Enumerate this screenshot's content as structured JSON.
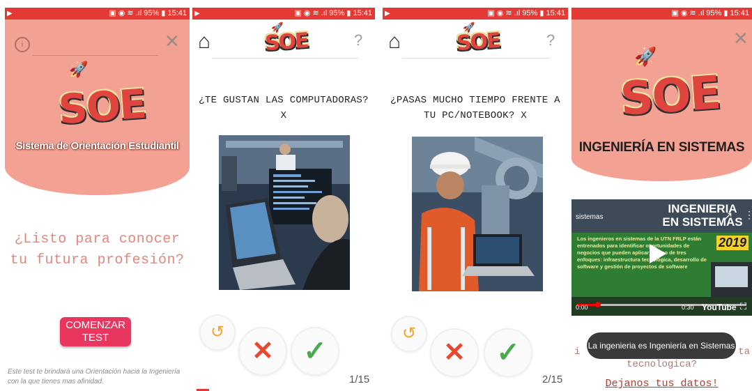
{
  "status_bar": {
    "battery": "95%",
    "time": "15:41"
  },
  "screen1": {
    "logo": "SOE",
    "subtitle": "Sistema de Orientación Estudiantil",
    "headline_line1": "¿Listo para conocer",
    "headline_line2": "tu futura profesión?",
    "start_button_line1": "COMENZAR",
    "start_button_line2": "TEST",
    "footnote_line1": "Este test te brindará una Orientación hacia la Ingeniería",
    "footnote_line2": "con la que tienes mas afinidad."
  },
  "screen2": {
    "logo": "SOE",
    "question_line1": "¿TE GUSTAN LAS COMPUTADORAS?",
    "question_line2": "X",
    "counter": "1/15"
  },
  "screen3": {
    "logo": "SOE",
    "question_line1": "¿PASAS MUCHO TIEMPO FRENTE A",
    "question_line2": "TU PC/NOTEBOOK? X",
    "counter": "2/15"
  },
  "screen4": {
    "logo": "SOE",
    "career_title": "INGENIERÍA EN SISTEMAS",
    "video": {
      "channel": "sistemas",
      "title_line1": "INGENIERIA",
      "title_line2": "EN SISTEMAS",
      "year": "2019",
      "body": "Los ingenieros en sistemas de la UTN FRLP están entrenados para identificar oportunidades de negocios que pueden aplicar en uno de tres enfoques: infraestructura tecnológica, desarrollo de software y gestión de proyectos de software",
      "time_current": "0:00",
      "time_total": "0:30",
      "brand": "YouTube"
    },
    "toast": "La ingenieria es Ingeniería en Sistemas",
    "line_before_toast": "i",
    "line_after_toast": "ta",
    "line_tech": "tecnologica?",
    "link": "Dejanos tus datos!"
  },
  "colors": {
    "salmon": "#f2a193",
    "status_red": "#e53935",
    "button_pink": "#e8365f",
    "logo_red": "#e0443f"
  },
  "icons": [
    "info-icon",
    "close-icon",
    "home-icon",
    "help-icon",
    "undo-icon",
    "reject-icon",
    "accept-icon",
    "play-icon",
    "share-icon",
    "menu-icon",
    "fullscreen-icon"
  ]
}
